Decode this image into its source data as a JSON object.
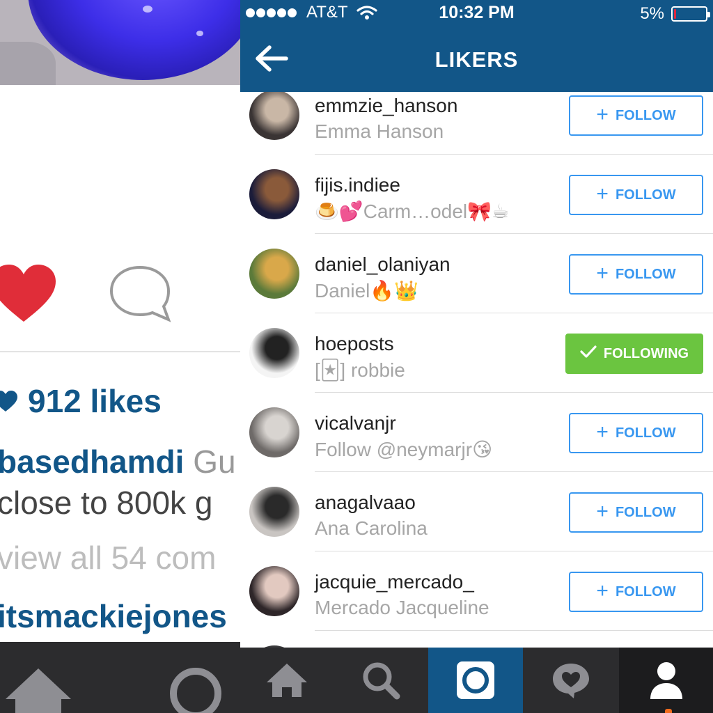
{
  "left_screen": {
    "likes_text": "912 likes",
    "caption_user": "basedhamdi",
    "caption_text": " Gu",
    "caption_line2": "close to 800k g",
    "view_comments": "view all 54 com",
    "comment_user": "itsmackiejones"
  },
  "status_bar": {
    "carrier": "AT&T",
    "time": "10:32 PM",
    "battery_text": "5%",
    "battery_level": 0.05
  },
  "nav": {
    "title": "LIKERS"
  },
  "likers": [
    {
      "username": "emmzie_hanson",
      "full_name": "Emma Hanson",
      "button": "FOLLOW",
      "following": false,
      "avatar_colors": [
        "#3a3434",
        "#c9b7a6"
      ]
    },
    {
      "username": "fijis.indiee",
      "full_name": "🍮💕Carm…odel🎀☕",
      "button": "FOLLOW",
      "following": false,
      "avatar_colors": [
        "#1b1c3a",
        "#8a5a3a"
      ]
    },
    {
      "username": "daniel_olaniyan",
      "full_name": "Daniel🔥👑",
      "button": "FOLLOW",
      "following": false,
      "avatar_colors": [
        "#5b7a3a",
        "#d9a84a"
      ]
    },
    {
      "username": "hoeposts",
      "full_name": "[🃏] robbie",
      "button": "FOLLOWING",
      "following": true,
      "avatar_colors": [
        "#f4f4f4",
        "#222222"
      ]
    },
    {
      "username": "vicalvanjr",
      "full_name": "Follow @neymarjr😘",
      "button": "FOLLOW",
      "following": false,
      "avatar_colors": [
        "#6e6a68",
        "#d8d4d0"
      ]
    },
    {
      "username": "anagalvaao",
      "full_name": "Ana Carolina",
      "button": "FOLLOW",
      "following": false,
      "avatar_colors": [
        "#c9c5c2",
        "#2a2a2a"
      ]
    },
    {
      "username": "jacquie_mercado_",
      "full_name": "Mercado Jacqueline",
      "button": "FOLLOW",
      "following": false,
      "avatar_colors": [
        "#2e2629",
        "#e2c9c0"
      ]
    }
  ],
  "icons": {
    "back": "arrow-left-icon",
    "wifi": "wifi-icon",
    "battery": "battery-icon",
    "tabs": [
      "home-icon",
      "search-icon",
      "camera-icon",
      "activity-heart-icon",
      "profile-icon"
    ]
  },
  "colors": {
    "brand_blue": "#125688",
    "follow_blue": "#3897f0",
    "following_green": "#6bc540",
    "like_red": "#e02d39",
    "tabbar": "#2c2c2e"
  }
}
